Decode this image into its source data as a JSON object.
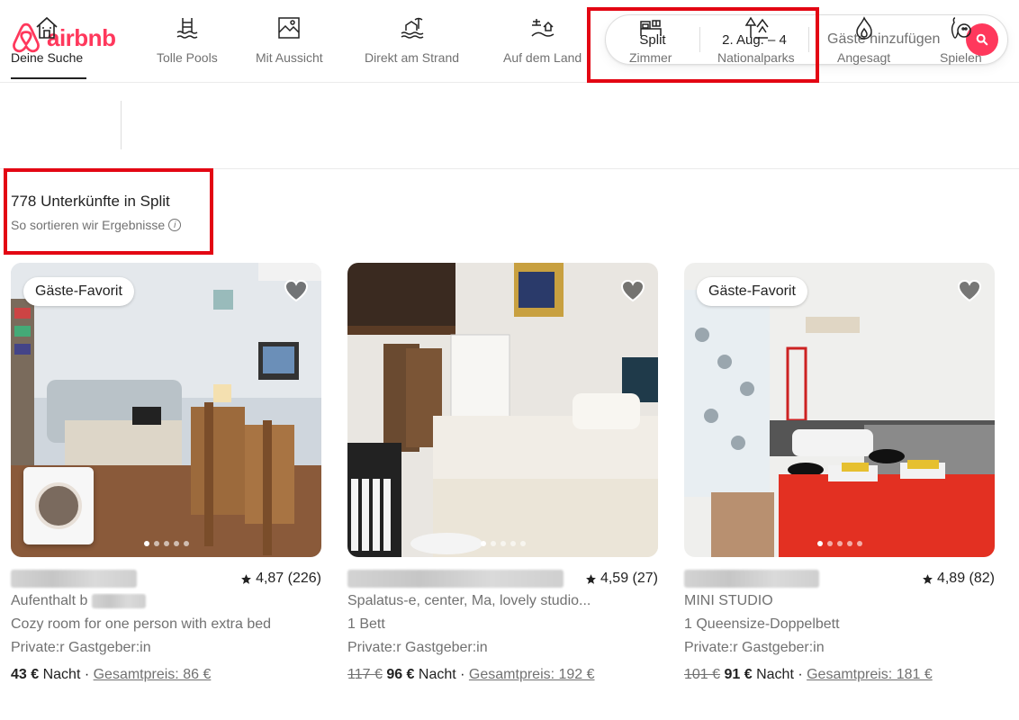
{
  "brand": {
    "name": "airbnb",
    "color": "#ff385c"
  },
  "search": {
    "location": "Split",
    "dates": "2. Aug. – 4",
    "guests_placeholder": "Gäste hinzufügen",
    "search_icon": "search-icon"
  },
  "categories": [
    {
      "label": "Deine Suche",
      "icon": "home-icon",
      "active": true
    },
    {
      "label": "Tolle Pools",
      "icon": "pool-icon"
    },
    {
      "label": "Mit Aussicht",
      "icon": "view-icon"
    },
    {
      "label": "Direkt am Strand",
      "icon": "beach-icon"
    },
    {
      "label": "Auf dem Land",
      "icon": "countryside-icon"
    },
    {
      "label": "Zimmer",
      "icon": "room-icon"
    },
    {
      "label": "Nationalparks",
      "icon": "national-park-icon"
    },
    {
      "label": "Angesagt",
      "icon": "flame-icon"
    },
    {
      "label": "Spielen",
      "icon": "bowling-icon"
    }
  ],
  "results": {
    "count": "778 Unterkünfte in Split",
    "sort_link": "So sortieren wir Ergebnisse"
  },
  "listings": [
    {
      "badge": "Gäste-Favorit",
      "rating": "4,87 (226)",
      "title": "Aufenthalt b",
      "description": "Cozy room for one person with extra bed",
      "host_type": "Private:r Gastgeber:in",
      "old_price": "",
      "price": "43 €",
      "price_unit": "Nacht",
      "total": "Gesamtpreis: 86 €",
      "active_dot": 0
    },
    {
      "badge": "",
      "rating": "4,59 (27)",
      "title": "Spalatus-e, center, Ma, lovely studio...",
      "description": "1 Bett",
      "host_type": "Private:r Gastgeber:in",
      "old_price": "117 €",
      "price": "96 €",
      "price_unit": "Nacht",
      "total": "Gesamtpreis: 192 €",
      "active_dot": 0
    },
    {
      "badge": "Gäste-Favorit",
      "rating": "4,89 (82)",
      "title": "MINI STUDIO",
      "description": "1 Queensize-Doppelbett",
      "host_type": "Private:r Gastgeber:in",
      "old_price": "101 €",
      "price": "91 €",
      "price_unit": "Nacht",
      "total": "Gesamtpreis: 181 €",
      "active_dot": 0
    }
  ],
  "colors": {
    "accent": "#ff385c",
    "highlight_box": "#e30613",
    "muted_text": "#717171"
  }
}
